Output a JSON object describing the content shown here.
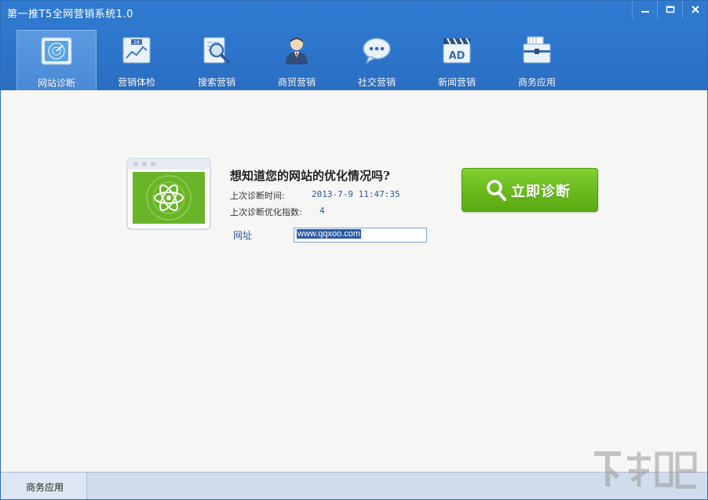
{
  "window": {
    "title": "第一推T5全网营销系统1.0"
  },
  "nav": {
    "items": [
      {
        "label": "网站诊断",
        "icon": "radar-icon",
        "active": true
      },
      {
        "label": "营销体检",
        "icon": "calendar-chart-icon",
        "active": false
      },
      {
        "label": "搜索营销",
        "icon": "magnifier-icon",
        "active": false
      },
      {
        "label": "商贸营销",
        "icon": "businessman-icon",
        "active": false
      },
      {
        "label": "社交营销",
        "icon": "chat-bubble-icon",
        "active": false
      },
      {
        "label": "新闻营销",
        "icon": "ad-clapper-icon",
        "active": false
      },
      {
        "label": "商务应用",
        "icon": "briefcase-icon",
        "active": false
      }
    ]
  },
  "main": {
    "heading": "想知道您的网站的优化情况吗?",
    "last_time_label": "上次诊断时间:",
    "last_time_value": "2013-7-9 11:47:35",
    "last_score_label": "上次诊断优化指数:",
    "last_score_value": "4",
    "url_label": "网址",
    "url_value": "www.qqxoo.com",
    "diagnose_button": "立即诊断"
  },
  "status": {
    "label": "商务应用"
  },
  "colors": {
    "header_blue": "#2d76cc",
    "button_green": "#6bbb1e",
    "value_blue": "#2c5aa0"
  }
}
